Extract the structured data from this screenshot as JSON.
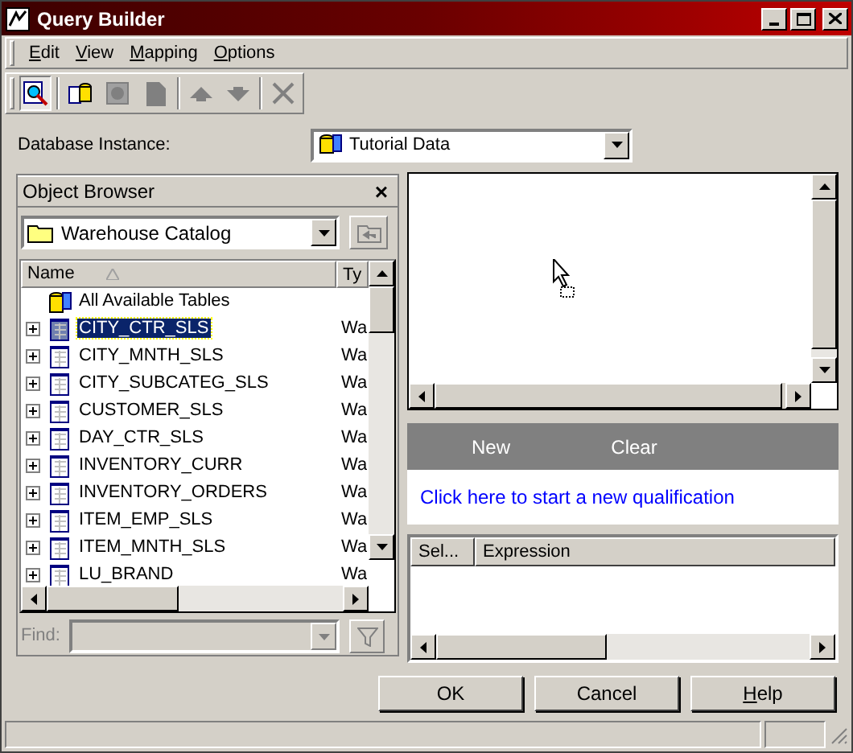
{
  "window": {
    "title": "Query Builder"
  },
  "menu": [
    "Edit",
    "View",
    "Mapping",
    "Options"
  ],
  "database_instance": {
    "label": "Database Instance:",
    "value": "Tutorial Data"
  },
  "object_browser": {
    "title": "Object Browser",
    "close": "×",
    "catalog": "Warehouse Catalog",
    "columns": [
      "Name",
      "Ty"
    ],
    "rows": [
      {
        "kind": "root",
        "name": "All Available Tables",
        "type": "",
        "selected": false
      },
      {
        "kind": "table",
        "name": "CITY_CTR_SLS",
        "type": "Wa",
        "selected": true
      },
      {
        "kind": "table",
        "name": "CITY_MNTH_SLS",
        "type": "Wa",
        "selected": false
      },
      {
        "kind": "table",
        "name": "CITY_SUBCATEG_SLS",
        "type": "Wa",
        "selected": false
      },
      {
        "kind": "table",
        "name": "CUSTOMER_SLS",
        "type": "Wa",
        "selected": false
      },
      {
        "kind": "table",
        "name": "DAY_CTR_SLS",
        "type": "Wa",
        "selected": false
      },
      {
        "kind": "table",
        "name": "INVENTORY_CURR",
        "type": "Wa",
        "selected": false
      },
      {
        "kind": "table",
        "name": "INVENTORY_ORDERS",
        "type": "Wa",
        "selected": false
      },
      {
        "kind": "table",
        "name": "ITEM_EMP_SLS",
        "type": "Wa",
        "selected": false
      },
      {
        "kind": "table",
        "name": "ITEM_MNTH_SLS",
        "type": "Wa",
        "selected": false
      },
      {
        "kind": "table",
        "name": "LU_BRAND",
        "type": "Wa",
        "selected": false
      }
    ],
    "find_label": "Find:"
  },
  "qualification": {
    "actions": [
      "New",
      "Clear"
    ],
    "link": "Click here to start a new qualification",
    "columns": [
      "Sel...",
      "Expression"
    ]
  },
  "buttons": [
    "OK",
    "Cancel",
    "Help"
  ]
}
